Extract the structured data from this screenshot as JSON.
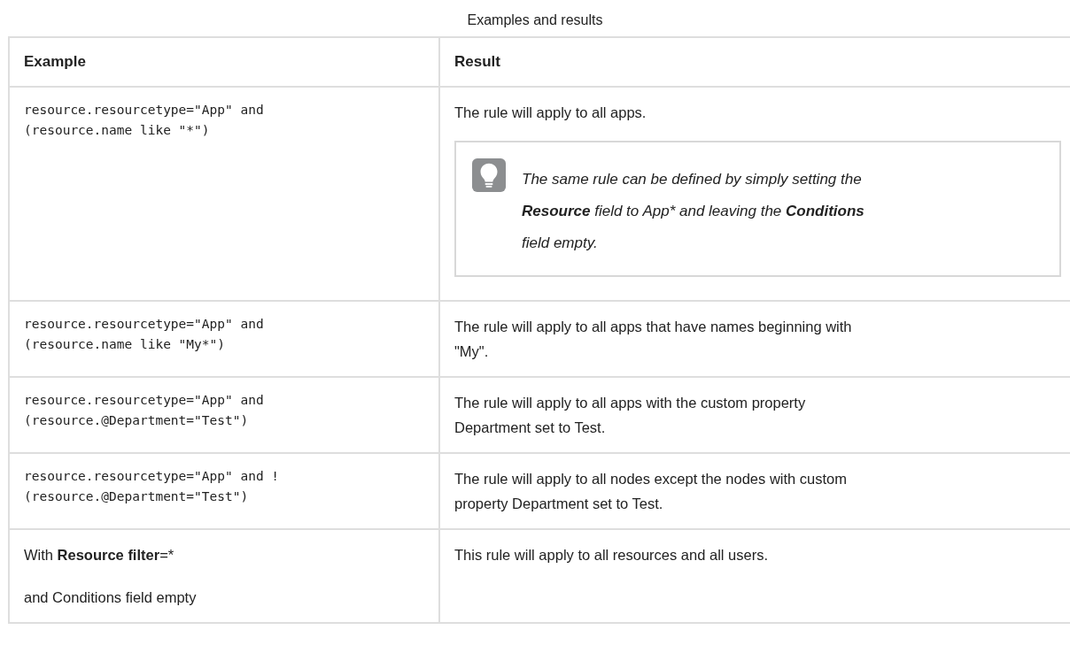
{
  "caption": "Examples and results",
  "table": {
    "columns": [
      "Example",
      "Result"
    ],
    "rows": [
      {
        "example": {
          "kind": "code",
          "lines": [
            "resource.resourcetype=\"App\" and",
            "(resource.name like \"*\")"
          ]
        },
        "result": {
          "lines": [
            "The rule will apply to all apps."
          ],
          "tip": {
            "lines": [
              "The same rule can be defined by simply setting the",
              "**Resource** field to App* and leaving the **Conditions**",
              "field empty."
            ]
          }
        }
      },
      {
        "example": {
          "kind": "code",
          "lines": [
            "resource.resourcetype=\"App\" and",
            "(resource.name like \"My*\")"
          ]
        },
        "result": {
          "lines": [
            "The rule will apply to all apps that have names beginning with",
            "\"My\"."
          ]
        }
      },
      {
        "example": {
          "kind": "code",
          "lines": [
            "resource.resourcetype=\"App\" and",
            "(resource.@Department=\"Test\")"
          ]
        },
        "result": {
          "lines": [
            "The rule will apply to all apps with the custom property",
            "Department set to Test."
          ]
        }
      },
      {
        "example": {
          "kind": "code",
          "lines": [
            "resource.resourcetype=\"App\" and !",
            "(resource.@Department=\"Test\")"
          ]
        },
        "result": {
          "lines": [
            "The rule will apply to all nodes except the nodes with custom",
            "property Department set to Test."
          ]
        }
      },
      {
        "example": {
          "kind": "text",
          "lines": [
            "With **Resource filter**=*",
            "and Conditions field empty"
          ]
        },
        "result": {
          "lines": [
            "This rule will apply to all resources and all users."
          ]
        }
      }
    ]
  }
}
